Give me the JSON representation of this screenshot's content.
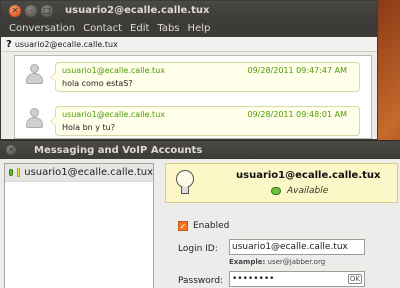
{
  "chat_window": {
    "title": "usuario2@ecalle.calle.tux",
    "menu": [
      "Conversation",
      "Contact",
      "Edit",
      "Tabs",
      "Help"
    ],
    "contact": "usuario2@ecalle.calle.tux",
    "messages": [
      {
        "from": "usuario1@ecalle.calle.tux",
        "time": "09/28/2011 09:47:47 AM",
        "text": "hola como estaS?"
      },
      {
        "from": "usuario1@ecalle.calle.tux",
        "time": "09/28/2011 09:48:01 AM",
        "text": "Hola bn y tu?"
      }
    ]
  },
  "accounts_window": {
    "title": "Messaging and VoIP Accounts",
    "accounts": [
      {
        "label": "usuario1@ecalle.calle.tux"
      }
    ],
    "detail": {
      "account_id": "usuario1@ecalle.calle.tux",
      "status": "Available",
      "enabled_label": "Enabled",
      "enabled": true,
      "login_label": "Login ID:",
      "login_value": "usuario1@ecalle.calle.tux",
      "example_prefix": "Example:",
      "example_value": "user@jabber.org",
      "password_label": "Password:",
      "password_value": "••••••••"
    }
  },
  "colors": {
    "accent_orange": "#f47421",
    "status_green": "#6ac13b",
    "bubble_bg": "#ffffea",
    "header_bg": "#fbf7c6"
  }
}
